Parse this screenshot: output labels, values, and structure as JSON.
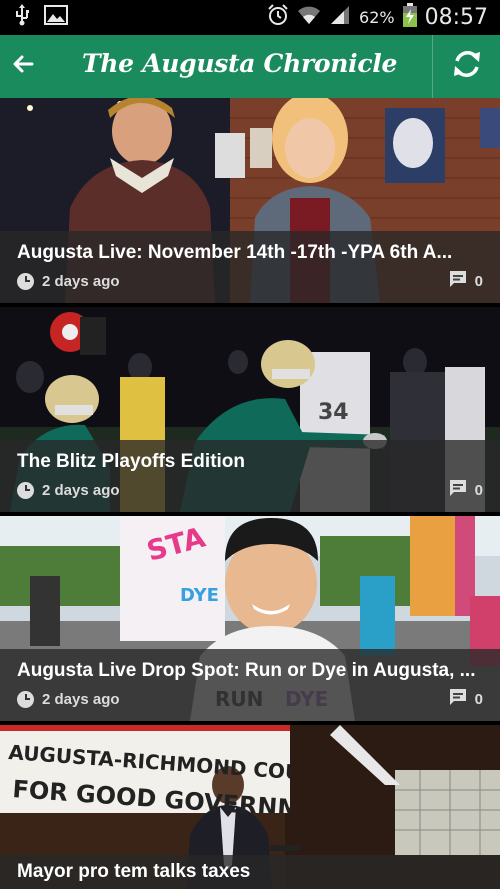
{
  "status_bar": {
    "left_icons": [
      "usb-icon",
      "image-icon"
    ],
    "right_icons": [
      "alarm-icon",
      "wifi-icon",
      "signal-icon",
      "battery-icon"
    ],
    "battery": "62%",
    "time": "08:57"
  },
  "app_bar": {
    "title": "The Augusta Chronicle",
    "back_icon": "arrow-back-icon",
    "refresh_icon": "refresh-icon",
    "color": "#1a8b5c"
  },
  "articles": [
    {
      "headline": "Augusta Live: November 14th -17th -YPA 6th A...",
      "time": "2 days ago",
      "comments": "0"
    },
    {
      "headline": "The Blitz Playoffs Edition",
      "time": "2 days ago",
      "comments": "0"
    },
    {
      "headline": "Augusta Live Drop Spot: Run or Dye in Augusta, ...",
      "time": "2 days ago",
      "comments": "0"
    },
    {
      "headline": "Mayor pro tem talks taxes"
    }
  ],
  "image_text": {
    "sign_line1": "AUGUSTA-RICHMOND COUNTY",
    "sign_line2": "FOR GOOD GOVERNMENT"
  }
}
